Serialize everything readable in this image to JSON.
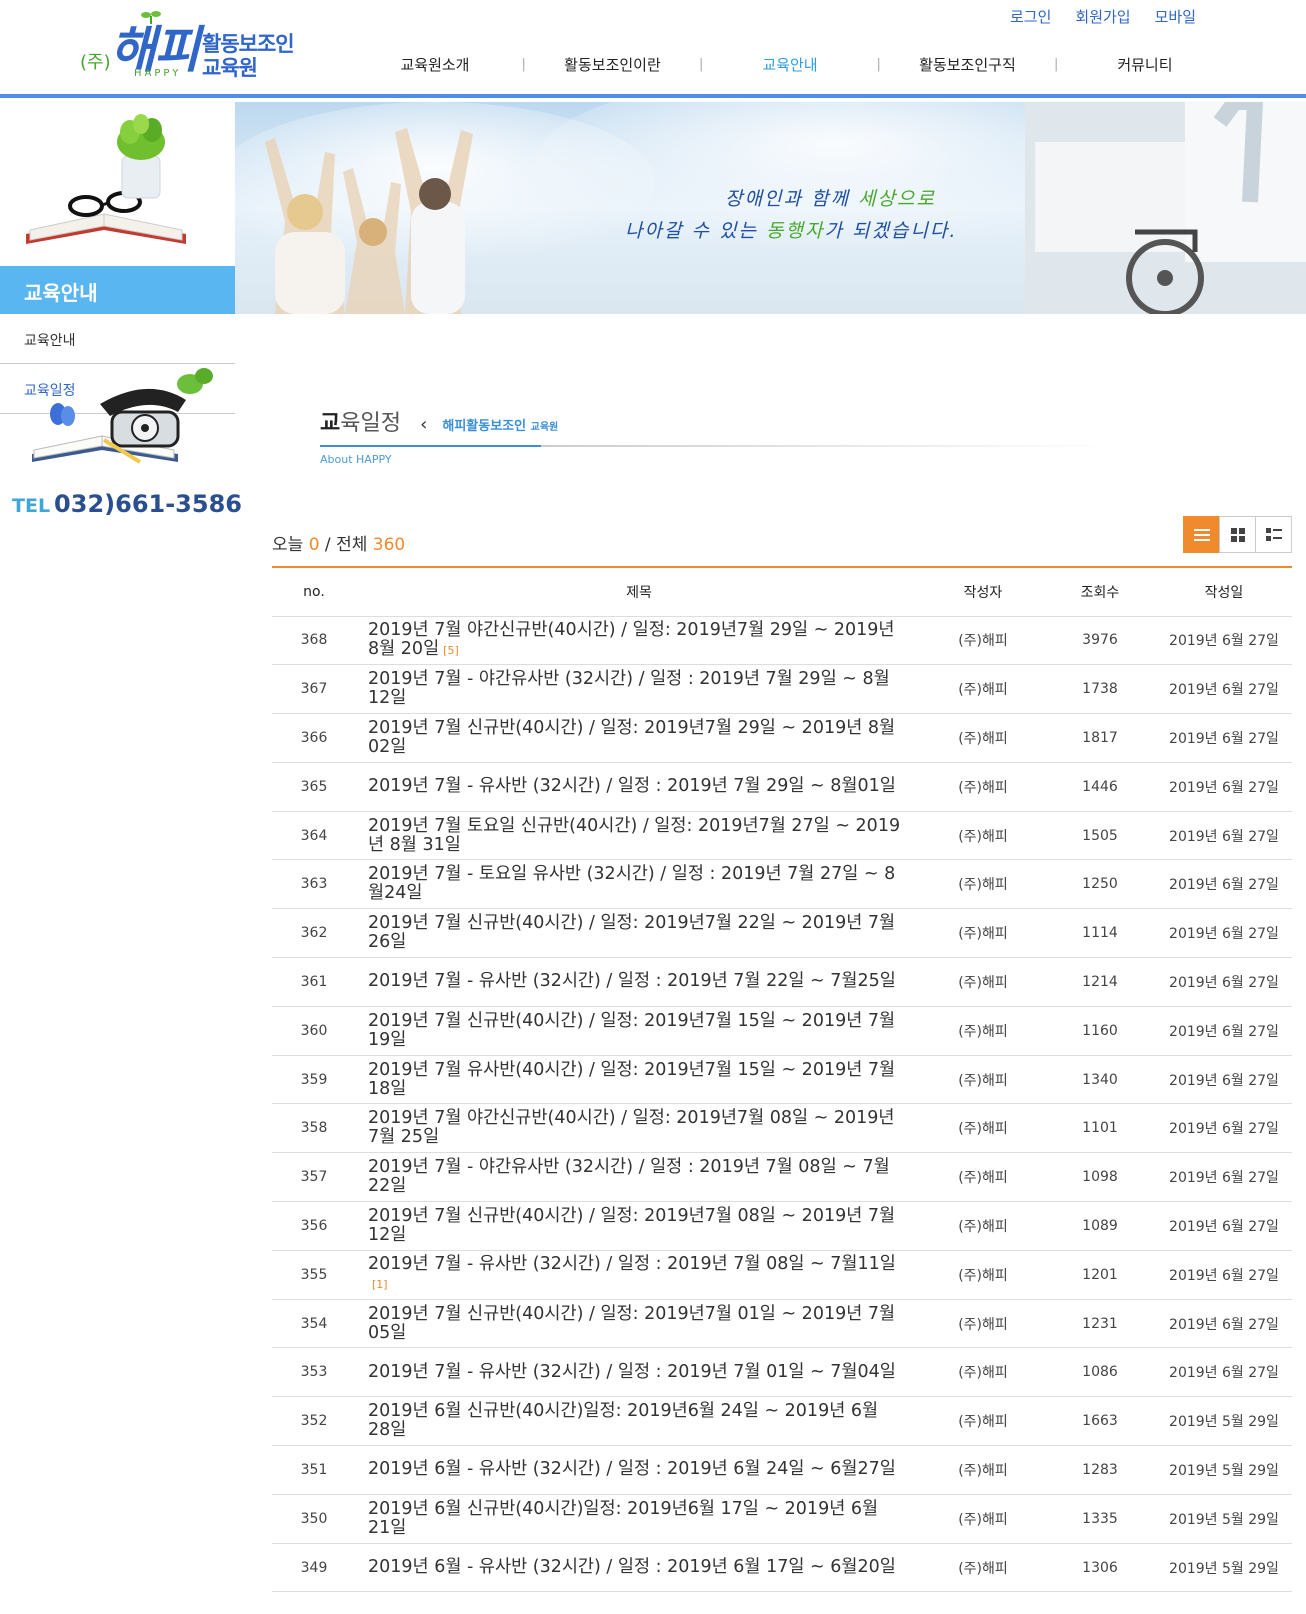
{
  "header": {
    "logo": {
      "prefix": "(주)",
      "brand": "해피",
      "brand_en": "HAPPY",
      "line1": "활동보조인",
      "line2": "교육원"
    },
    "util_links": [
      "로그인",
      "회원가입",
      "모바일"
    ],
    "nav": [
      "교육원소개",
      "활동보조인이란",
      "교육안내",
      "활동보조인구직",
      "커뮤니티"
    ],
    "nav_separator": "|",
    "active_nav": "교육안내"
  },
  "sidebar": {
    "title": "교육안내",
    "items": [
      "교육안내",
      "교육일정"
    ],
    "active_item": "교육일정",
    "tel_label": "TEL",
    "tel_number": "032)661-3586"
  },
  "banner": {
    "slogan_line1_a": "장애인과 함께 ",
    "slogan_line1_b": "세상으로",
    "slogan_line2_a": "나아갈 수 있는 ",
    "slogan_line2_b": "동행자",
    "slogan_line2_c": "가 되겠습니다."
  },
  "page": {
    "title_first": "교",
    "title_rest": "육일정",
    "breadcrumb": "해피활동보조인",
    "breadcrumb_small": "교육원",
    "subtitle": "About HAPPY"
  },
  "board": {
    "today_label": "오늘",
    "today_count": "0",
    "separator": "/",
    "total_label": "전체",
    "total_count": "360",
    "columns": [
      "no.",
      "제목",
      "작성자",
      "조회수",
      "작성일"
    ],
    "rows": [
      {
        "no": "368",
        "subject": "2019년 7월 야간신규반(40시간) / 일정: 2019년7월 29일 ~ 2019년 8월 20일",
        "comments": "[5]",
        "author": "(주)해피",
        "views": "3976",
        "date": "2019년 6월 27일"
      },
      {
        "no": "367",
        "subject": "2019년 7월  - 야간유사반 (32시간)   /   일정  :  2019년 7월 29일 ~ 8월12일",
        "comments": "",
        "author": "(주)해피",
        "views": "1738",
        "date": "2019년 6월 27일"
      },
      {
        "no": "366",
        "subject": "2019년 7월 신규반(40시간)  /  일정: 2019년7월 29일 ~ 2019년 8월 02일",
        "comments": "",
        "author": "(주)해피",
        "views": "1817",
        "date": "2019년 6월 27일"
      },
      {
        "no": "365",
        "subject": "2019년 7월  - 유사반 (32시간)  /  일정  :  2019년 7월 29일 ~ 8월01일",
        "comments": "",
        "author": "(주)해피",
        "views": "1446",
        "date": "2019년 6월 27일"
      },
      {
        "no": "364",
        "subject": "2019년 7월 토요일 신규반(40시간)  /  일정: 2019년7월 27일 ~ 2019년 8월 31일",
        "comments": "",
        "author": "(주)해피",
        "views": "1505",
        "date": "2019년 6월 27일"
      },
      {
        "no": "363",
        "subject": "2019년 7월  - 토요일 유사반 (32시간)  /  일정  :  2019년 7월 27일 ~ 8월24일",
        "comments": "",
        "author": "(주)해피",
        "views": "1250",
        "date": "2019년 6월 27일"
      },
      {
        "no": "362",
        "subject": "2019년 7월 신규반(40시간)  /  일정: 2019년7월 22일 ~ 2019년 7월 26일",
        "comments": "",
        "author": "(주)해피",
        "views": "1114",
        "date": "2019년 6월 27일"
      },
      {
        "no": "361",
        "subject": "2019년 7월  - 유사반 (32시간)  /  일정  :  2019년 7월 22일 ~ 7월25일",
        "comments": "",
        "author": "(주)해피",
        "views": "1214",
        "date": "2019년 6월 27일"
      },
      {
        "no": "360",
        "subject": "2019년 7월 신규반(40시간)  /  일정: 2019년7월 15일 ~ 2019년 7월 19일",
        "comments": "",
        "author": "(주)해피",
        "views": "1160",
        "date": "2019년 6월 27일"
      },
      {
        "no": "359",
        "subject": "2019년 7월 유사반(40시간) / 일정: 2019년7월 15일 ~ 2019년 7월 18일",
        "comments": "",
        "author": "(주)해피",
        "views": "1340",
        "date": "2019년 6월 27일"
      },
      {
        "no": "358",
        "subject": "2019년 7월 야간신규반(40시간) / 일정: 2019년7월 08일 ~ 2019년 7월 25일",
        "comments": "",
        "author": "(주)해피",
        "views": "1101",
        "date": "2019년 6월 27일"
      },
      {
        "no": "357",
        "subject": "2019년 7월  - 야간유사반 (32시간)   /   일정  :  2019년 7월 08일 ~ 7월22일",
        "comments": "",
        "author": "(주)해피",
        "views": "1098",
        "date": "2019년 6월 27일"
      },
      {
        "no": "356",
        "subject": "2019년 7월 신규반(40시간)  / 일정: 2019년7월 08일 ~ 2019년 7월 12일",
        "comments": "",
        "author": "(주)해피",
        "views": "1089",
        "date": "2019년 6월 27일"
      },
      {
        "no": "355",
        "subject": "2019년 7월  - 유사반 (32시간)   /   일정  :  2019년 7월 08일 ~ 7월11일",
        "comments": "[1]",
        "author": "(주)해피",
        "views": "1201",
        "date": "2019년 6월 27일"
      },
      {
        "no": "354",
        "subject": "2019년 7월 신규반(40시간) / 일정: 2019년7월 01일 ~ 2019년 7월 05일",
        "comments": "",
        "author": "(주)해피",
        "views": "1231",
        "date": "2019년 6월 27일"
      },
      {
        "no": "353",
        "subject": "2019년 7월  - 유사반 (32시간)   /   일정  :  2019년 7월 01일 ~ 7월04일",
        "comments": "",
        "author": "(주)해피",
        "views": "1086",
        "date": "2019년 6월 27일"
      },
      {
        "no": "352",
        "subject": "2019년 6월 신규반(40시간)일정: 2019년6월 24일 ~ 2019년 6월 28일",
        "comments": "",
        "author": "(주)해피",
        "views": "1663",
        "date": "2019년 5월 29일"
      },
      {
        "no": "351",
        "subject": "2019년 6월  - 유사반 (32시간)   /   일정  :  2019년 6월 24일 ~ 6월27일",
        "comments": "",
        "author": "(주)해피",
        "views": "1283",
        "date": "2019년 5월 29일"
      },
      {
        "no": "350",
        "subject": "2019년 6월 신규반(40시간)일정: 2019년6월 17일 ~ 2019년 6월 21일",
        "comments": "",
        "author": "(주)해피",
        "views": "1335",
        "date": "2019년 5월 29일"
      },
      {
        "no": "349",
        "subject": "2019년 6월  - 유사반 (32시간)   /   일정  :  2019년 6월 17일 ~ 6월20일",
        "comments": "",
        "author": "(주)해피",
        "views": "1306",
        "date": "2019년 5월 29일"
      }
    ]
  },
  "icons": {
    "view_list": "list-view-icon",
    "view_gallery": "gallery-view-icon",
    "view_webzine": "webzine-view-icon",
    "chevron": "chevron-left-icon"
  },
  "colors": {
    "brand_blue": "#2f66c8",
    "accent_orange": "#f08a2c",
    "side_title_bg": "#5ab6f0",
    "nav_active": "#2f9ee0"
  }
}
